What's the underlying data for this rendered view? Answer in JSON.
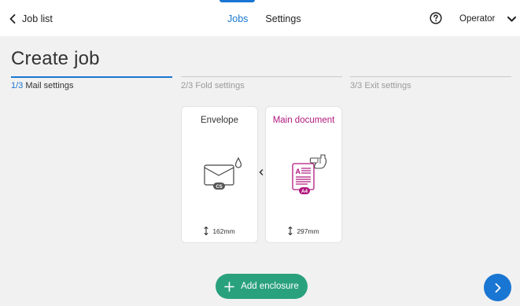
{
  "topbar": {
    "back_label": "Job list",
    "tabs": [
      {
        "label": "Jobs",
        "active": true
      },
      {
        "label": "Settings",
        "active": false
      }
    ],
    "help_icon": "help-circle-icon",
    "user_label": "Operator"
  },
  "page": {
    "title": "Create job"
  },
  "steps": [
    {
      "number": "1/3",
      "label": "Mail settings",
      "active": true
    },
    {
      "number": "2/3",
      "label": "Fold settings",
      "active": false
    },
    {
      "number": "3/3",
      "label": "Exit settings",
      "active": false
    }
  ],
  "cards": {
    "envelope": {
      "title": "Envelope",
      "format": "C5",
      "size": "162mm",
      "icon": "envelope-icon"
    },
    "document": {
      "title": "Main document",
      "format": "A4",
      "size": "297mm",
      "icon": "document-hand-icon"
    }
  },
  "actions": {
    "add_enclosure_label": "Add enclosure",
    "next_icon": "chevron-right-icon"
  },
  "colors": {
    "accent": "#1976d2",
    "document": "#b0187e",
    "add_button": "#2aa17d"
  }
}
